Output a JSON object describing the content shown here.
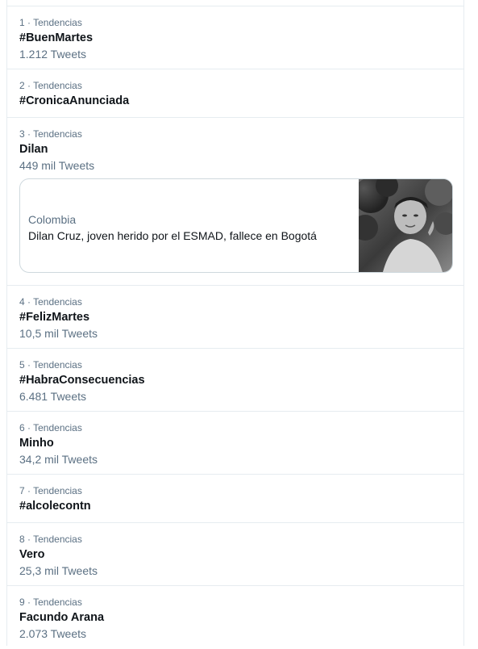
{
  "trends": [
    {
      "rank": "1",
      "meta": "1 · Tendencias",
      "name": "#BuenMartes",
      "count": "1.212 Tweets"
    },
    {
      "rank": "2",
      "meta": "2 · Tendencias",
      "name": "#CronicaAnunciada",
      "count": ""
    },
    {
      "rank": "3",
      "meta": "3 · Tendencias",
      "name": "Dilan",
      "count": "449 mil Tweets"
    },
    {
      "rank": "4",
      "meta": "4 · Tendencias",
      "name": "#FelizMartes",
      "count": "10,5 mil Tweets"
    },
    {
      "rank": "5",
      "meta": "5 · Tendencias",
      "name": "#HabraConsecuencias",
      "count": "6.481 Tweets"
    },
    {
      "rank": "6",
      "meta": "6 · Tendencias",
      "name": "Minho",
      "count": "34,2 mil Tweets"
    },
    {
      "rank": "7",
      "meta": "7 · Tendencias",
      "name": "#alcolecontn",
      "count": ""
    },
    {
      "rank": "8",
      "meta": "8 · Tendencias",
      "name": "Vero",
      "count": "25,3 mil Tweets"
    },
    {
      "rank": "9",
      "meta": "9 · Tendencias",
      "name": "Facundo Arana",
      "count": "2.073 Tweets"
    }
  ],
  "news_card": {
    "country": "Colombia",
    "headline": "Dilan Cruz, joven herido por el ESMAD, fallece en Bogotá",
    "image": "news-thumbnail-photo"
  },
  "colors": {
    "text_primary": "#0f1419",
    "text_secondary": "#5b7083",
    "divider": "#e6ecf0"
  }
}
